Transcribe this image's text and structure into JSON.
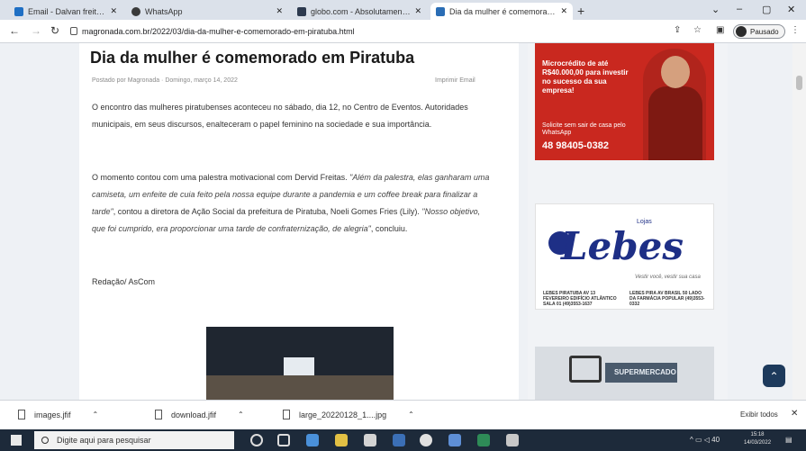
{
  "browser": {
    "tabs": [
      {
        "label": "Email - Dalvan freitas - Outlook",
        "icon_color": "#1f6fc4"
      },
      {
        "label": "WhatsApp",
        "icon_color": "#3a3a3a"
      },
      {
        "label": "globo.com - Absolutamente tudo",
        "icon_color": "#2d3a4f"
      },
      {
        "label": "Dia da mulher é comemorado em",
        "icon_color": "#2a6db5"
      }
    ],
    "new_tab_label": "+",
    "url": "magronada.com.br/2022/03/dia-da-mulher-e-comemorado-em-piratuba.html",
    "profile_label": "Pausado",
    "window_controls": {
      "dropdown": "⌄",
      "minimize": "–",
      "maximize": "▢",
      "close": "✕"
    }
  },
  "article": {
    "title": "Dia da mulher é comemorado em Piratuba",
    "byline": "Postado por Magronada · Domingo, março 14, 2022",
    "share": "Imprimir   Email",
    "p1": "O encontro das mulheres piratubenses aconteceu no sábado, dia 12, no Centro de Eventos. Autoridades municipais, em seus discursos, enalteceram o papel feminino na sociedade e sua importância.",
    "p2_plain_1": "O momento contou com uma palestra motivacional com Dervid Freitas. ",
    "p2_italic_1": "\"Além da palestra, elas ganharam uma camiseta, um enfeite de cuia feito pela nossa equipe durante a pandemia e um coffee break para finalizar a tarde\"",
    "p2_plain_2": ", contou a diretora de Ação Social da prefeitura de Piratuba, Noeli Gomes Fries (Lily). ",
    "p2_italic_2": "\"Nosso objetivo, que foi cumprido, era proporcionar uma tarde de confraternização, de alegria\"",
    "p2_plain_3": ", concluiu.",
    "p3": "Redação/ AsCom"
  },
  "ads": {
    "ad1_text": "Microcrédito de até R$40.000,00 para investir no sucesso da sua empresa!",
    "ad1_whats": "Solicite sem sair de casa pelo WhatsApp",
    "ad1_phone": "48 98405-0382",
    "lebes_lojas": "Lojas",
    "lebes_brand": "Lebes",
    "lebes_slogan": "Vestir você, vestir sua casa",
    "lebes_addr1": "LEBES PIRATUBA AV 13 FEVEREIRO EDIFÍCIO ATLÂNTICO SALA 01 (49)3553-1637",
    "lebes_addr2": "LEBES PIRA AV BRASIL 50 LADO DA FARMÁCIA POPULAR (49)3553-0332",
    "ad3_text": "SUPERMERCADO"
  },
  "downloads": {
    "items": [
      {
        "name": "images.jfif"
      },
      {
        "name": "download.jfif"
      },
      {
        "name": "large_20220128_1....jpg"
      }
    ],
    "show_all": "Exibir todos",
    "close": "✕"
  },
  "taskbar": {
    "search_placeholder": "Digite aqui para pesquisar",
    "time": "15:18",
    "date": "14/03/2022",
    "tray": "^ ▭ ◁ 40"
  },
  "colors": {
    "ad_red": "#c9281f",
    "lebes_blue": "#1e2f86",
    "taskbar": "#1d2a3a"
  }
}
